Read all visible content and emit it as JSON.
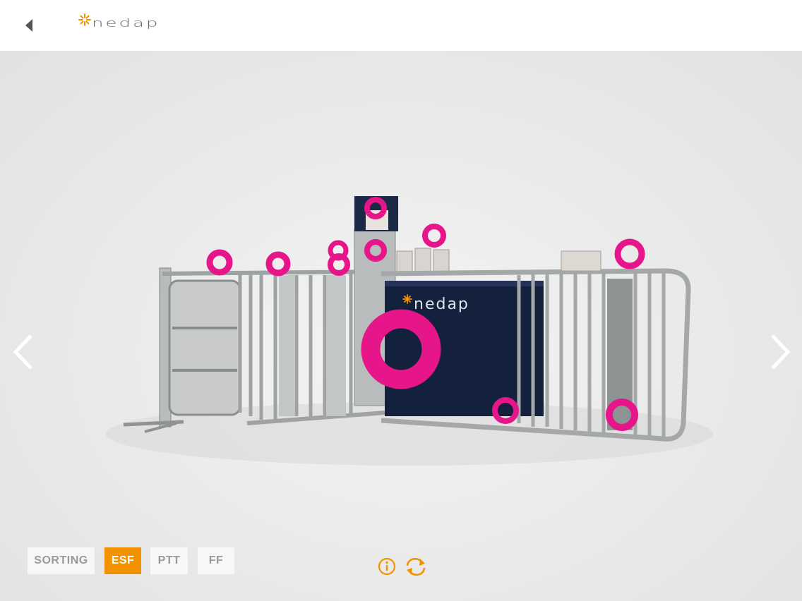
{
  "header": {
    "logo_text": "nedap",
    "back_icon": "chevron-left-icon"
  },
  "viewer": {
    "prev_icon": "chevron-left-icon",
    "next_icon": "chevron-right-icon",
    "panel_logo_text": "nedap",
    "hotspot_color": "#e6168a"
  },
  "tabs": [
    {
      "label": "SORTING",
      "active": false
    },
    {
      "label": "ESF",
      "active": true
    },
    {
      "label": "PTT",
      "active": false
    },
    {
      "label": "FF",
      "active": false
    }
  ],
  "toolbar": {
    "info_icon": "info-icon",
    "rotate_icon": "refresh-icon"
  },
  "colors": {
    "accent": "#f39200",
    "hotspot": "#e6168a",
    "panel": "#14213d",
    "header_bg": "#ffffff",
    "stage_bg": "#e6e6e6"
  }
}
